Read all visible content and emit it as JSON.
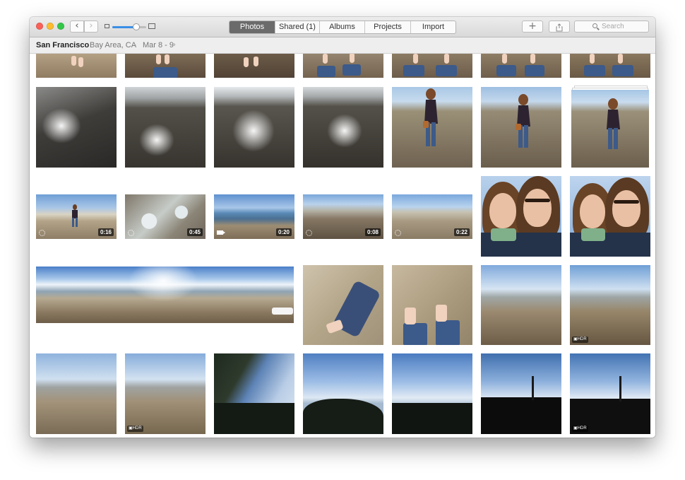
{
  "window": {
    "nav": {
      "back_glyph": "‹",
      "forward_glyph": "›"
    },
    "zoom": {
      "level_fraction": 0.7
    },
    "tabs": [
      {
        "label": "Photos",
        "active": true
      },
      {
        "label": "Shared (1)",
        "active": false
      },
      {
        "label": "Albums",
        "active": false
      },
      {
        "label": "Projects",
        "active": false
      },
      {
        "label": "Import",
        "active": false
      }
    ],
    "toolbar": {
      "add_glyph": "+",
      "share_icon": "share-icon"
    },
    "search": {
      "placeholder": "Search"
    }
  },
  "location": {
    "title": "San Francisco",
    "subtitle": "Bay Area, CA",
    "separator": "·",
    "date_range": "Mar 8 - 9",
    "chevron": "›"
  },
  "photos": {
    "row2": [
      {
        "id": 1
      },
      {
        "id": 2
      },
      {
        "id": 3
      },
      {
        "id": 4
      },
      {
        "id": 5
      },
      {
        "id": 6
      },
      {
        "id": 7
      }
    ],
    "videos": [
      {
        "duration": "0:16",
        "badge": "spinner-icon"
      },
      {
        "duration": "0:45",
        "badge": "spinner-icon"
      },
      {
        "duration": "0:20",
        "badge": "video-camera-icon"
      },
      {
        "duration": "0:08",
        "badge": "spinner-icon"
      },
      {
        "duration": "0:22",
        "badge": "spinner-icon"
      }
    ],
    "hdr_label": "HDR"
  },
  "colors": {
    "active_tab": "#6b6b6b",
    "zoom_accent": "#3a8ee6",
    "sky": "#6f9fd6",
    "sand": "#b9a88d"
  }
}
